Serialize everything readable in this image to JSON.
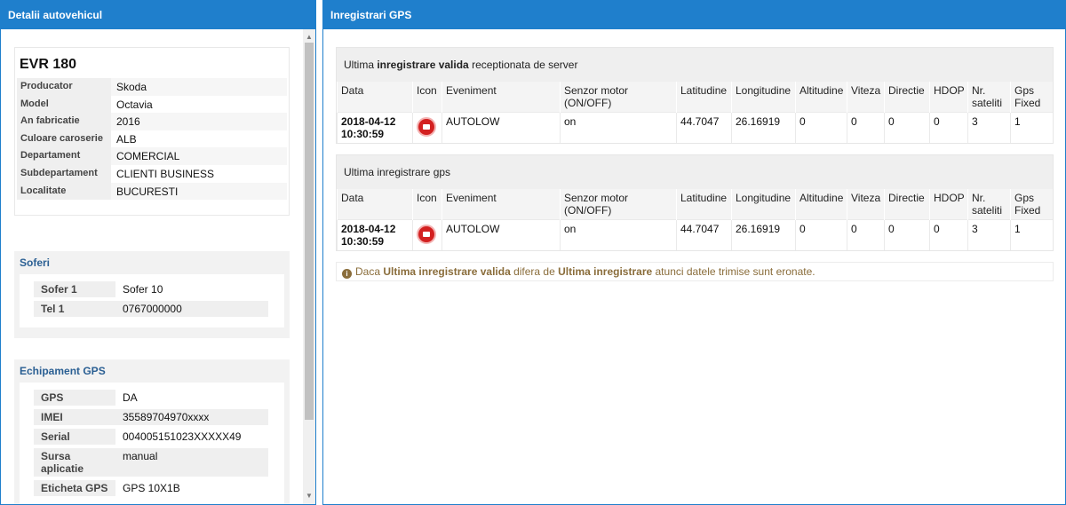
{
  "left_panel": {
    "title": "Detalii autovehicul",
    "vehicle": {
      "plate": "EVR 180",
      "fields": [
        {
          "label": "Producator",
          "value": "Skoda"
        },
        {
          "label": "Model",
          "value": "Octavia"
        },
        {
          "label": "An fabricatie",
          "value": "2016"
        },
        {
          "label": "Culoare caroserie",
          "value": "ALB"
        },
        {
          "label": "Departament",
          "value": "COMERCIAL"
        },
        {
          "label": "Subdepartament",
          "value": "CLIENTI BUSINESS"
        },
        {
          "label": "Localitate",
          "value": "BUCURESTI"
        }
      ]
    },
    "soferi": {
      "title": "Soferi",
      "rows": [
        {
          "label": "Sofer 1",
          "value": "Sofer 10"
        },
        {
          "label": "Tel 1",
          "value": "0767000000"
        }
      ]
    },
    "echipament": {
      "title": "Echipament GPS",
      "rows": [
        {
          "label": "GPS",
          "value": "DA"
        },
        {
          "label": "IMEI",
          "value": "35589704970xxxx"
        },
        {
          "label": "Serial",
          "value": "004005151023XXXXX49"
        },
        {
          "label": "Sursa aplicatie",
          "value": "manual"
        },
        {
          "label": "Eticheta GPS",
          "value": "GPS 10X1B"
        }
      ]
    }
  },
  "right_panel": {
    "title": "Inregistrari GPS",
    "block1": {
      "caption_pre": "Ultima ",
      "caption_bold": "inregistrare valida",
      "caption_post": " receptionata de server"
    },
    "block2": {
      "caption": "Ultima inregistrare gps"
    },
    "columns": [
      "Data",
      "Icon",
      "Eveniment",
      "Senzor motor (ON/OFF)",
      "Latitudine",
      "Longitudine",
      "Altitudine",
      "Viteza",
      "Directie",
      "HDOP",
      "Nr. sateliti",
      "Gps Fixed"
    ],
    "record": {
      "date": "2018-04-12 10:30:59",
      "icon": "event-stop-icon",
      "event": "AUTOLOW",
      "engine": "on",
      "lat": "44.7047",
      "lon": "26.16919",
      "alt": "0",
      "speed": "0",
      "dir": "0",
      "hdop": "0",
      "sats": "3",
      "fixed": "1"
    },
    "note": {
      "p1": "Daca ",
      "b1": "Ultima inregistrare valida",
      "p2": " difera de ",
      "b2": "Ultima inregistrare",
      "p3": " atunci datele trimise sunt eronate."
    }
  },
  "colors": {
    "header_blue": "#1f7fcc",
    "section_title": "#2a5f93",
    "note_text": "#8a6d3b",
    "event_red": "#d32020"
  }
}
